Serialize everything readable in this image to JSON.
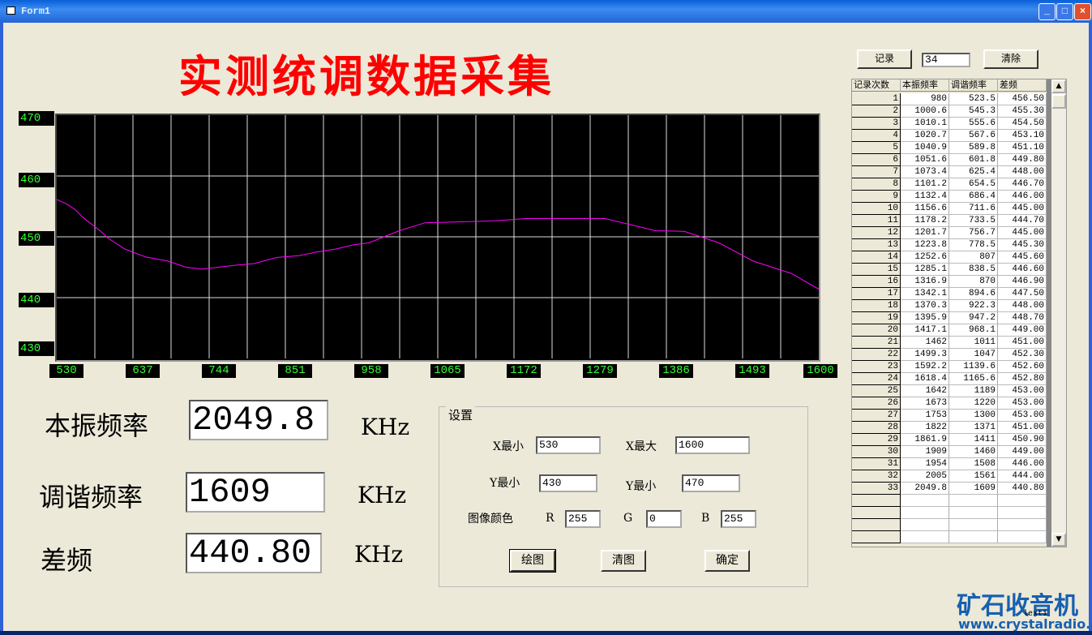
{
  "window": {
    "title": "Form1",
    "minimize": "_",
    "maximize": "□",
    "close": "×"
  },
  "heading": "实测统调数据采集",
  "chart_data": {
    "type": "line",
    "xlim": [
      530,
      1600
    ],
    "ylim": [
      430,
      470
    ],
    "x_ticks": [
      "530",
      "637",
      "744",
      "851",
      "958",
      "1065",
      "1172",
      "1279",
      "1386",
      "1493",
      "1600"
    ],
    "y_ticks": [
      "470",
      "460",
      "450",
      "440",
      "430"
    ],
    "grid": true,
    "line_color": "#ff00ff",
    "background": "#000000",
    "x": [
      523.5,
      545.3,
      555.6,
      567.6,
      589.8,
      601.8,
      625.4,
      654.5,
      686.4,
      711.6,
      733.5,
      756.7,
      778.5,
      807,
      838.5,
      870,
      894.6,
      922.3,
      947.2,
      968.1,
      1011,
      1047,
      1139.6,
      1165.6,
      1189,
      1220,
      1300,
      1371,
      1411,
      1460,
      1508,
      1561,
      1609
    ],
    "y": [
      456.5,
      455.3,
      454.5,
      453.1,
      451.1,
      449.8,
      448.0,
      446.7,
      446.0,
      445.0,
      444.7,
      445.0,
      445.3,
      445.6,
      446.6,
      446.9,
      447.5,
      448.0,
      448.7,
      449.0,
      451.0,
      452.3,
      452.6,
      452.8,
      453.0,
      453.0,
      453.0,
      451.0,
      450.9,
      449.0,
      446.0,
      444.0,
      440.8
    ]
  },
  "readouts": [
    {
      "label": "本振频率",
      "value": "2049.8",
      "unit": "KHz"
    },
    {
      "label": "调谐频率",
      "value": "1609",
      "unit": "KHz"
    },
    {
      "label": "差频",
      "value": "440.80",
      "unit": "KHz"
    }
  ],
  "settings": {
    "legend": "设置",
    "xmin_label": "X最小",
    "xmin": "530",
    "xmax_label": "X最大",
    "xmax": "1600",
    "ymin_label": "Y最小",
    "ymin": "430",
    "ymax_label": "Y最小",
    "ymax": "470",
    "color_label": "图像颜色",
    "r_label": "R",
    "r": "255",
    "g_label": "G",
    "g": "0",
    "b_label": "B",
    "b": "255",
    "draw": "绘图",
    "clear": "清图",
    "ok": "确定"
  },
  "record": {
    "button": "记录",
    "count": "34",
    "clear": "清除"
  },
  "table": {
    "headers": [
      "记录次数",
      "本振频率",
      "调谐频率",
      "差频"
    ],
    "rows": [
      [
        "1",
        "980",
        "523.5",
        "456.50"
      ],
      [
        "2",
        "1000.6",
        "545.3",
        "455.30"
      ],
      [
        "3",
        "1010.1",
        "555.6",
        "454.50"
      ],
      [
        "4",
        "1020.7",
        "567.6",
        "453.10"
      ],
      [
        "5",
        "1040.9",
        "589.8",
        "451.10"
      ],
      [
        "6",
        "1051.6",
        "601.8",
        "449.80"
      ],
      [
        "7",
        "1073.4",
        "625.4",
        "448.00"
      ],
      [
        "8",
        "1101.2",
        "654.5",
        "446.70"
      ],
      [
        "9",
        "1132.4",
        "686.4",
        "446.00"
      ],
      [
        "10",
        "1156.6",
        "711.6",
        "445.00"
      ],
      [
        "11",
        "1178.2",
        "733.5",
        "444.70"
      ],
      [
        "12",
        "1201.7",
        "756.7",
        "445.00"
      ],
      [
        "13",
        "1223.8",
        "778.5",
        "445.30"
      ],
      [
        "14",
        "1252.6",
        "807",
        "445.60"
      ],
      [
        "15",
        "1285.1",
        "838.5",
        "446.60"
      ],
      [
        "16",
        "1316.9",
        "870",
        "446.90"
      ],
      [
        "17",
        "1342.1",
        "894.6",
        "447.50"
      ],
      [
        "18",
        "1370.3",
        "922.3",
        "448.00"
      ],
      [
        "19",
        "1395.9",
        "947.2",
        "448.70"
      ],
      [
        "20",
        "1417.1",
        "968.1",
        "449.00"
      ],
      [
        "21",
        "1462",
        "1011",
        "451.00"
      ],
      [
        "22",
        "1499.3",
        "1047",
        "452.30"
      ],
      [
        "23",
        "1592.2",
        "1139.6",
        "452.60"
      ],
      [
        "24",
        "1618.4",
        "1165.6",
        "452.80"
      ],
      [
        "25",
        "1642",
        "1189",
        "453.00"
      ],
      [
        "26",
        "1673",
        "1220",
        "453.00"
      ],
      [
        "27",
        "1753",
        "1300",
        "453.00"
      ],
      [
        "28",
        "1822",
        "1371",
        "451.00"
      ],
      [
        "29",
        "1861.9",
        "1411",
        "450.90"
      ],
      [
        "30",
        "1909",
        "1460",
        "449.00"
      ],
      [
        "31",
        "1954",
        "1508",
        "446.00"
      ],
      [
        "32",
        "2005",
        "1561",
        "444.00"
      ],
      [
        "33",
        "2049.8",
        "1609",
        "440.80"
      ]
    ]
  },
  "watermark": {
    "logo": "矿石收音机",
    "url": "www.crystalradio.cn"
  },
  "caret_label": "lexti"
}
